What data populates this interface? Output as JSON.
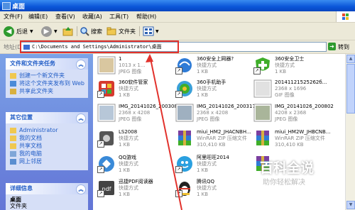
{
  "window": {
    "title": "桌面"
  },
  "menu": [
    "文件(F)",
    "编辑(E)",
    "查看(V)",
    "收藏(A)",
    "工具(T)",
    "帮助(H)"
  ],
  "toolbar": {
    "back": "后退",
    "search": "搜索",
    "folders": "文件夹"
  },
  "address": {
    "label": "地址(D)",
    "value": "C:\\Documents and Settings\\Administrator\\桌面",
    "go": "转到"
  },
  "tasks": {
    "title": "文件和文件夹任务",
    "items": [
      "创建一个新文件夹",
      "将这个文件夹发布到 Web",
      "共享此文件夹"
    ]
  },
  "places": {
    "title": "其它位置",
    "items": [
      "Administrator",
      "我的文档",
      "共享文档",
      "我的电脑",
      "网上邻居"
    ]
  },
  "details": {
    "title": "详细信息",
    "name": "桌面",
    "type": "文件夹"
  },
  "files": [
    {
      "name": "1",
      "l2": "1013 x 1...",
      "l3": "JPEG 图像",
      "icon": "photo",
      "color": "#d9c7a0"
    },
    {
      "name": "360安全上网器?",
      "l2": "快捷方式",
      "l3": "1 KB",
      "icon": "browser",
      "color": "#2e7bd6"
    },
    {
      "name": "360安全卫士",
      "l2": "快捷方式",
      "l3": "1 KB",
      "icon": "shield",
      "color": "#3fae2a"
    },
    {
      "name": "360软件管家",
      "l2": "快捷方式",
      "l3": "1 KB",
      "icon": "app",
      "color": "#d63a2e"
    },
    {
      "name": "360手机助手",
      "l2": "快捷方式",
      "l3": "1 KB",
      "icon": "app",
      "color": "#3aa0d8"
    },
    {
      "name": "20141121525262б...",
      "l2": "2368 x 1696",
      "l3": "GIF 图像",
      "icon": "photo",
      "color": "#e1e1e1"
    },
    {
      "name": "IMG_20141026_200308",
      "l2": "2368 x 4208",
      "l3": "JPEG 图像",
      "icon": "photo",
      "color": "#b7c7d8"
    },
    {
      "name": "IMG_20141026_200317",
      "l2": "2368 x 4208",
      "l3": "JPEG 图像",
      "icon": "photo",
      "color": "#9fb0c0"
    },
    {
      "name": "IMG_20141026_200802",
      "l2": "4208 x 2368",
      "l3": "JPEG 图像",
      "icon": "photo",
      "color": "#a9b59a"
    },
    {
      "name": "LS2008",
      "l2": "快捷方式",
      "l3": "1 KB",
      "icon": "app",
      "color": "#555555"
    },
    {
      "name": "miui_HM2_JHACNBH...",
      "l2": "WinRAR ZIP 压缩文件",
      "l3": "310,410 KB",
      "icon": "rar",
      "color": "#7a3fa0"
    },
    {
      "name": "miui_HM2W_JHBCNB...",
      "l2": "WinRAR ZIP 压缩文件",
      "l3": "310,410 KB",
      "icon": "rar",
      "color": "#7a3fa0"
    },
    {
      "name": "QQ游戏",
      "l2": "快捷方式",
      "l3": "1 KB",
      "icon": "app",
      "color": "#3a8ad8"
    },
    {
      "name": "阿里旺旺2014",
      "l2": "快捷方式",
      "l3": "1 KB",
      "icon": "app",
      "color": "#2aa0e0"
    },
    {
      "name": "",
      "l2": "",
      "l3": "",
      "icon": "rar",
      "color": "#7a3fa0"
    },
    {
      "name": "迅捷PDF阅读器",
      "l2": "快捷方式",
      "l3": "1 KB",
      "icon": "pdf",
      "color": "#444444"
    },
    {
      "name": "腾讯QQ",
      "l2": "快捷方式",
      "l3": "1 KB",
      "icon": "qq",
      "color": "#f0c030"
    }
  ],
  "watermark": {
    "line1": "百科全说",
    "line2": "助你轻松解决"
  }
}
